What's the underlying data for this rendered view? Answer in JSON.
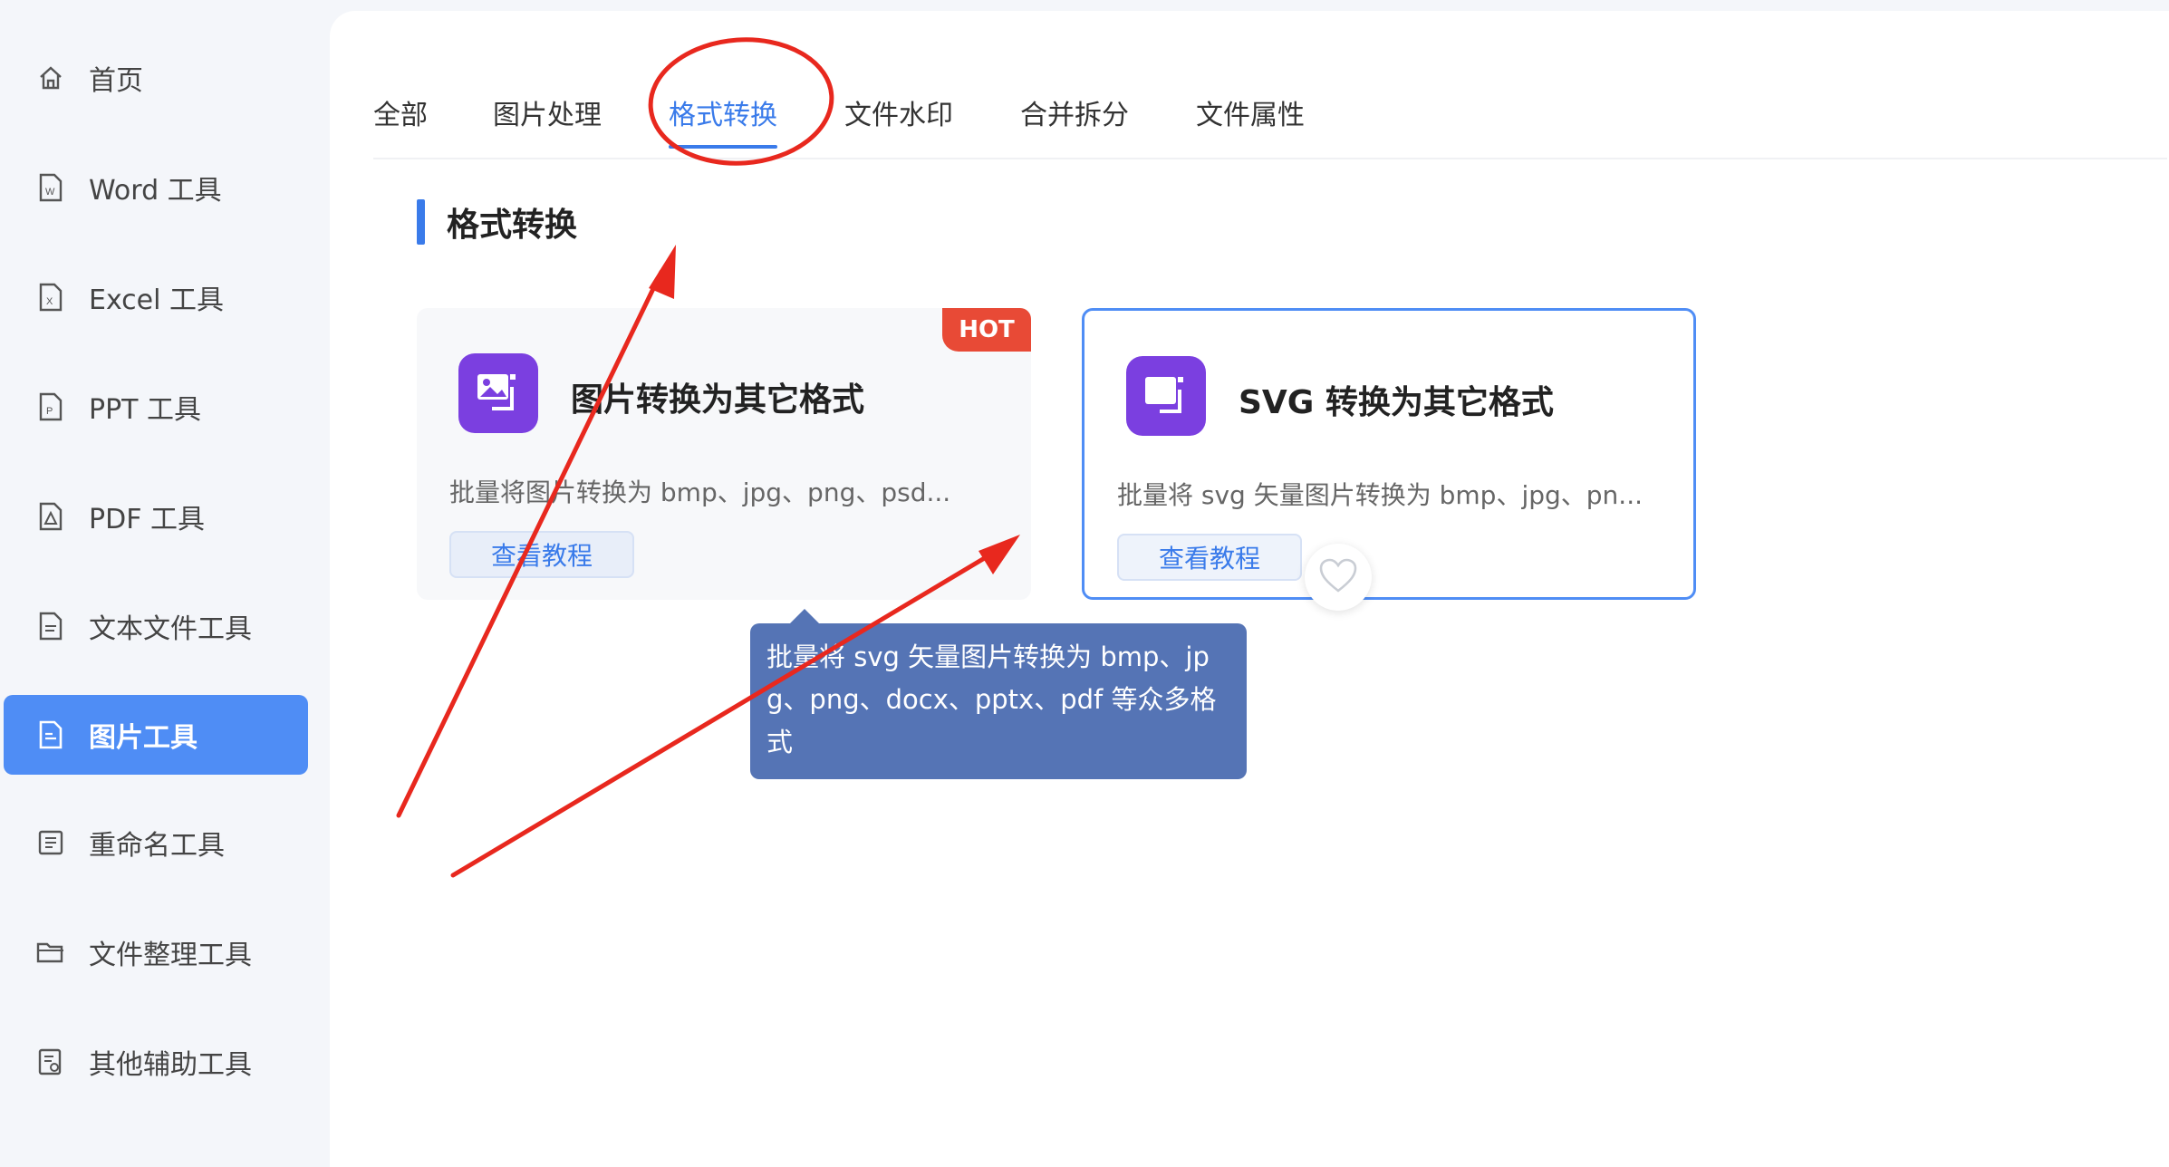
{
  "sidebar": {
    "items": [
      {
        "label": "首页",
        "icon": "home-icon"
      },
      {
        "label": "Word 工具",
        "icon": "word-file-icon"
      },
      {
        "label": "Excel 工具",
        "icon": "excel-file-icon"
      },
      {
        "label": "PPT 工具",
        "icon": "ppt-file-icon"
      },
      {
        "label": "PDF 工具",
        "icon": "pdf-file-icon"
      },
      {
        "label": "文本文件工具",
        "icon": "text-file-icon"
      },
      {
        "label": "图片工具",
        "icon": "image-file-icon",
        "active": true
      },
      {
        "label": "重命名工具",
        "icon": "rename-icon"
      },
      {
        "label": "文件整理工具",
        "icon": "folder-icon"
      },
      {
        "label": "其他辅助工具",
        "icon": "misc-tools-icon"
      }
    ]
  },
  "tabs": [
    {
      "label": "全部"
    },
    {
      "label": "图片处理"
    },
    {
      "label": "格式转换",
      "active": true
    },
    {
      "label": "文件水印"
    },
    {
      "label": "合并拆分"
    },
    {
      "label": "文件属性"
    }
  ],
  "section": {
    "title": "格式转换"
  },
  "cards": [
    {
      "title": "图片转换为其它格式",
      "desc": "批量将图片转换为 bmp、jpg、png、psd...",
      "button": "查看教程",
      "badge": "HOT"
    },
    {
      "title": "SVG 转换为其它格式",
      "desc": "批量将 svg 矢量图片转换为 bmp、jpg、pn...",
      "button": "查看教程"
    }
  ],
  "tooltip": {
    "text": "批量将 svg 矢量图片转换为 bmp、jpg、png、docx、pptx、pdf 等众多格式"
  },
  "colors": {
    "accent": "#3a7bea",
    "sidebar_active": "#4f8df5",
    "hot_badge": "#e84a36",
    "app_icon": "#7b3fe0",
    "tooltip_bg": "#5574b5",
    "annotation": "#e8281e"
  }
}
